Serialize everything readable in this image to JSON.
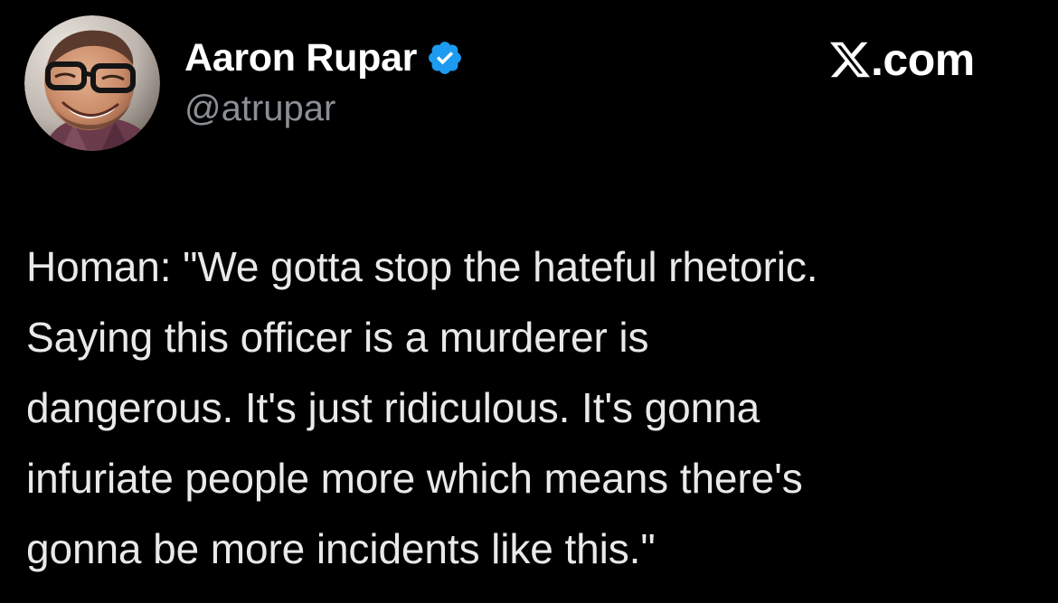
{
  "tweet": {
    "author": {
      "name": "Aaron Rupar",
      "handle": "@atrupar",
      "verified": true,
      "avatar_icon": "profile-photo"
    },
    "site": {
      "logo_icon": "x-logo-icon",
      "domain_suffix": ".com"
    },
    "text": "Homan: \"We gotta stop the hateful rhetoric.\nSaying this officer is a murderer is\ndangerous. It's just ridiculous. It's gonna\ninfuriate people more which means there's\ngonna be more incidents like this.\""
  },
  "colors": {
    "background": "#000000",
    "name": "#ffffff",
    "handle": "#8b8f94",
    "text": "#e8e9ea",
    "verified": "#1d9bf0"
  }
}
